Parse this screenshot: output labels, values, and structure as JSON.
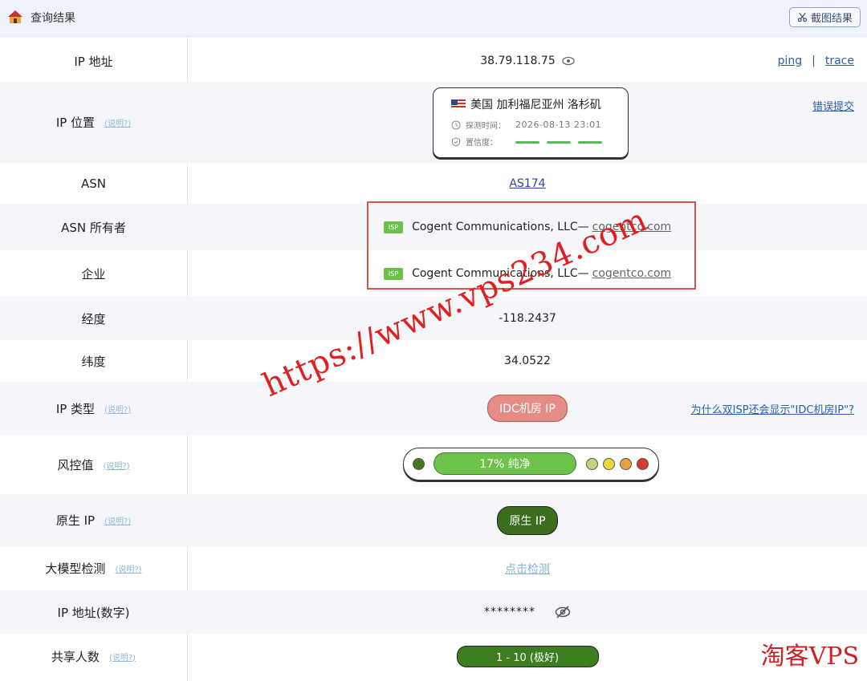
{
  "header": {
    "title": "查询结果",
    "screenshot_label": "截图结果"
  },
  "rows": {
    "ip": {
      "label": "IP 地址",
      "value": "38.79.118.75",
      "link_ping": "ping",
      "link_sep": "|",
      "link_trace": "trace"
    },
    "location": {
      "label": "IP 位置",
      "help": "(说明?)",
      "place": "美国 加利福尼亚州 洛杉矶",
      "time_label": "探测时间：",
      "time_value": "2026-08-13 23:01",
      "confidence_label": "置信度：",
      "confidence_level": 3,
      "report_link": "错误提交"
    },
    "asn": {
      "label": "ASN",
      "value": "AS174"
    },
    "asn_owner": {
      "label": "ASN 所有者",
      "badge": "ISP",
      "name": "Cogent Communications, LLC—",
      "domain": "cogentco.com"
    },
    "company": {
      "label": "企业",
      "badge": "ISP",
      "name": "Cogent Communications, LLC—",
      "domain": "cogentco.com"
    },
    "longitude": {
      "label": "经度",
      "value": "-118.2437"
    },
    "latitude": {
      "label": "纬度",
      "value": "34.0522"
    },
    "ip_type": {
      "label": "IP 类型",
      "help": "(说明?)",
      "value": "IDC机房 IP",
      "side_link": "为什么双ISP还会显示\"IDC机房IP\"?"
    },
    "risk": {
      "label": "风控值",
      "help": "(说明?)",
      "value": "17%  纯净",
      "score_percent": 17
    },
    "native": {
      "label": "原生 IP",
      "help": "(说明?)",
      "value": "原生 IP"
    },
    "llm": {
      "label": "大模型检测",
      "help": "(说明?)",
      "value": "点击检测"
    },
    "ip_numeric": {
      "label": "IP 地址(数字)",
      "value": "********"
    },
    "shared": {
      "label": "共享人数",
      "help": "(说明?)",
      "value": "1 - 10 (极好)"
    }
  },
  "watermark": "https://www.vps234.com",
  "brand": "淘客VPS",
  "colors": {
    "accent_link": "#2b5fa8",
    "risk_green": "#6dc24b",
    "idc_red": "#e58c86",
    "native_green": "#3a6d1e",
    "highlight_box": "#d9534f"
  },
  "icons": [
    "house-icon",
    "scissors-icon",
    "eye-icon",
    "us-flag-icon",
    "clock-icon",
    "shield-icon",
    "eye-off-icon"
  ]
}
